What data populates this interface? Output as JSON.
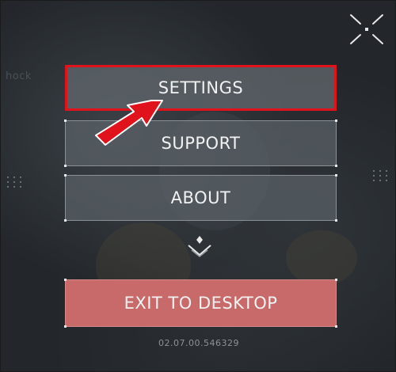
{
  "menu": {
    "settings_label": "SETTINGS",
    "support_label": "SUPPORT",
    "about_label": "ABOUT",
    "exit_label": "EXIT TO DESKTOP"
  },
  "background": {
    "partial_text": "hock"
  },
  "footer": {
    "version": "02.07.00.546329"
  },
  "icons": {
    "expand": "expand-icon",
    "scroll_down": "chevron-down-icon",
    "pointer": "red-arrow-icon"
  },
  "colors": {
    "highlight_border": "#e0121b",
    "exit_button": "#c86a6a",
    "button_bg": "#5c6268",
    "annotation_arrow": "#e0121b"
  }
}
